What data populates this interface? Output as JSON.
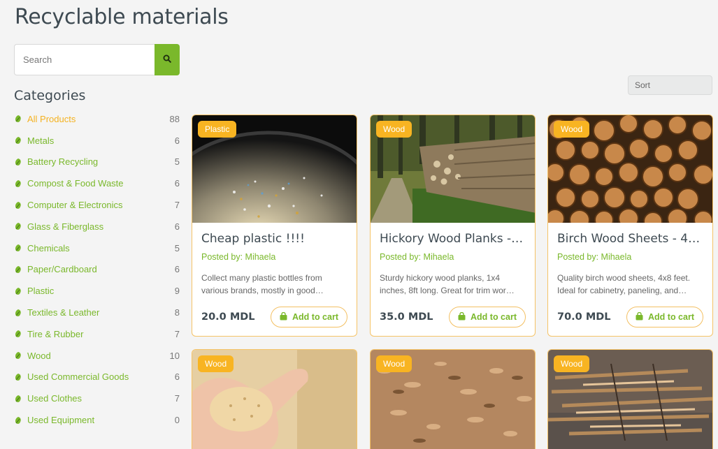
{
  "page": {
    "title": "Recyclable materials"
  },
  "search": {
    "placeholder": "Search",
    "icon": "search-icon"
  },
  "sidebar": {
    "heading": "Categories",
    "items": [
      {
        "label": "All Products",
        "count": "88",
        "active": true
      },
      {
        "label": "Metals",
        "count": "6"
      },
      {
        "label": "Battery Recycling",
        "count": "5"
      },
      {
        "label": "Compost & Food Waste",
        "count": "6"
      },
      {
        "label": "Computer & Electronics",
        "count": "7"
      },
      {
        "label": "Glass & Fiberglass",
        "count": "6"
      },
      {
        "label": "Chemicals",
        "count": "5"
      },
      {
        "label": "Paper/Cardboard",
        "count": "6"
      },
      {
        "label": "Plastic",
        "count": "9"
      },
      {
        "label": "Textiles & Leather",
        "count": "8"
      },
      {
        "label": "Tire & Rubber",
        "count": "7"
      },
      {
        "label": "Wood",
        "count": "10"
      },
      {
        "label": "Used Commercial Goods",
        "count": "6"
      },
      {
        "label": "Used Clothes",
        "count": "7"
      },
      {
        "label": "Used Equipment",
        "count": "0"
      }
    ]
  },
  "sort": {
    "placeholder": "Sort"
  },
  "products": [
    {
      "badge": "Plastic",
      "title": "Cheap plastic !!!!",
      "author": "Posted by: Mihaela",
      "description": "Collect many plastic bottles from various brands, mostly in good…",
      "price": "20.0 MDL",
      "cart_label": "Add to cart"
    },
    {
      "badge": "Wood",
      "title": "Hickory Wood Planks -…",
      "author": "Posted by: Mihaela",
      "description": "Sturdy hickory wood planks, 1x4 inches, 8ft long. Great for trim wor…",
      "price": "35.0 MDL",
      "cart_label": "Add to cart"
    },
    {
      "badge": "Wood",
      "title": "Birch Wood Sheets - 4…",
      "author": "Posted by: Mihaela",
      "description": "Quality birch wood sheets, 4x8 feet. Ideal for cabinetry, paneling, and…",
      "price": "70.0 MDL",
      "cart_label": "Add to cart"
    },
    {
      "badge": "Wood"
    },
    {
      "badge": "Wood"
    },
    {
      "badge": "Wood"
    }
  ],
  "colors": {
    "accent_green": "#7ab82b",
    "accent_orange": "#f8b422",
    "card_border": "#f5c366",
    "title_text": "#3e4a52"
  }
}
